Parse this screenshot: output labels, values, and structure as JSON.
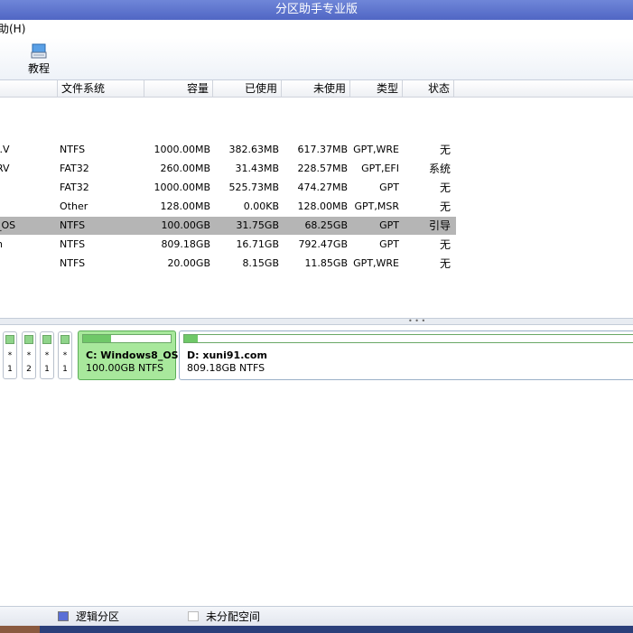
{
  "window": {
    "title": "分区助手专业版"
  },
  "menu": {
    "help_label": "助(H)"
  },
  "toolbar": {
    "tutorial_label": "教程",
    "tutorial_icon": "book-icon"
  },
  "columns": [
    "文件系统",
    "容量",
    "已使用",
    "未使用",
    "类型",
    "状态"
  ],
  "rows": [
    {
      "name": "..V",
      "fs": "NTFS",
      "capacity": "1000.00MB",
      "used": "382.63MB",
      "free": "617.37MB",
      "type": "GPT,WRE",
      "status": "无"
    },
    {
      "name": "RV",
      "fs": "FAT32",
      "capacity": "260.00MB",
      "used": "31.43MB",
      "free": "228.57MB",
      "type": "GPT,EFI",
      "status": "系统"
    },
    {
      "name": "",
      "fs": "FAT32",
      "capacity": "1000.00MB",
      "used": "525.73MB",
      "free": "474.27MB",
      "type": "GPT",
      "status": "无"
    },
    {
      "name": "",
      "fs": "Other",
      "capacity": "128.00MB",
      "used": "0.00KB",
      "free": "128.00MB",
      "type": "GPT,MSR",
      "status": "无"
    },
    {
      "name": "_OS",
      "fs": "NTFS",
      "capacity": "100.00GB",
      "used": "31.75GB",
      "free": "68.25GB",
      "type": "GPT",
      "status": "引导"
    },
    {
      "name": "n",
      "fs": "NTFS",
      "capacity": "809.18GB",
      "used": "16.71GB",
      "free": "792.47GB",
      "type": "GPT",
      "status": "无"
    },
    {
      "name": "",
      "fs": "NTFS",
      "capacity": "20.00GB",
      "used": "8.15GB",
      "free": "11.85GB",
      "type": "GPT,WRE",
      "status": "无"
    }
  ],
  "diskmap": {
    "small_parts": [
      {
        "star": "*",
        "num": "1"
      },
      {
        "star": "*",
        "num": "2"
      },
      {
        "star": "*",
        "num": "1"
      },
      {
        "star": "*",
        "num": "1"
      }
    ],
    "partitions": [
      {
        "name": "C: Windows8_OS",
        "info": "100.00GB NTFS",
        "used_fraction": 0.32
      },
      {
        "name": "D: xuni91.com",
        "info": "809.18GB NTFS",
        "used_fraction": 0.02
      }
    ]
  },
  "legend": {
    "logical": "逻辑分区",
    "unallocated": "未分配空间",
    "logical_color": "#5a6fd6",
    "unallocated_color": "#ffffff"
  }
}
